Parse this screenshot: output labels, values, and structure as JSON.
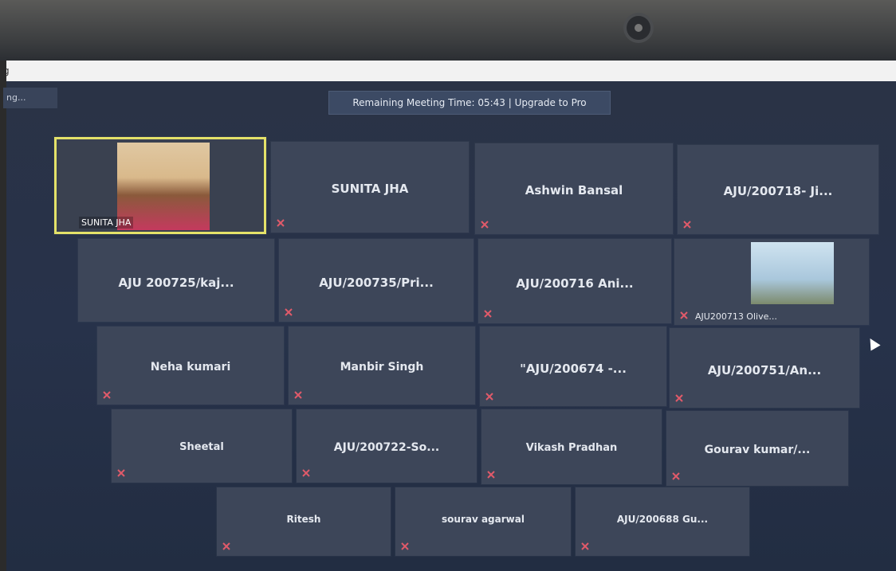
{
  "window": {
    "title_fragment": "g",
    "status_fragment": "ng..."
  },
  "banner": {
    "text": "Remaining Meeting Time: 05:43 | Upgrade to Pro"
  },
  "colors": {
    "active_speaker_border": "#e4e269",
    "tile_bg": "#3d4659",
    "muted_icon": "#e05a6a"
  },
  "participants": [
    {
      "name": "SUNITA JHA",
      "video": true,
      "feed_label": "SUNITA JHA"
    },
    {
      "name": "SUNITA JHA",
      "muted": true
    },
    {
      "name": "Ashwin Bansal",
      "muted": true
    },
    {
      "name": "AJU/200718- Ji...",
      "muted": true
    },
    {
      "name": "AJU 200725/kaj..."
    },
    {
      "name": "AJU/200735/Pri...",
      "muted": true
    },
    {
      "name": "AJU/200716 Ani...",
      "muted": true
    },
    {
      "name": "AJU200713 Olive...",
      "thumbnail": true,
      "muted": true
    },
    {
      "name": "Neha kumari",
      "muted": true
    },
    {
      "name": "Manbir Singh",
      "muted": true
    },
    {
      "name": "\"AJU/200674 -...",
      "muted": true
    },
    {
      "name": "AJU/200751/An...",
      "muted": true
    },
    {
      "name": "Sheetal",
      "muted": true
    },
    {
      "name": "AJU/200722-So...",
      "muted": true
    },
    {
      "name": "Vikash Pradhan",
      "muted": true
    },
    {
      "name": "Gourav  kumar/...",
      "muted": true
    },
    {
      "name": "Ritesh",
      "muted": true
    },
    {
      "name": "sourav agarwal",
      "muted": true
    },
    {
      "name": "AJU/200688 Gu...",
      "muted": true
    }
  ]
}
